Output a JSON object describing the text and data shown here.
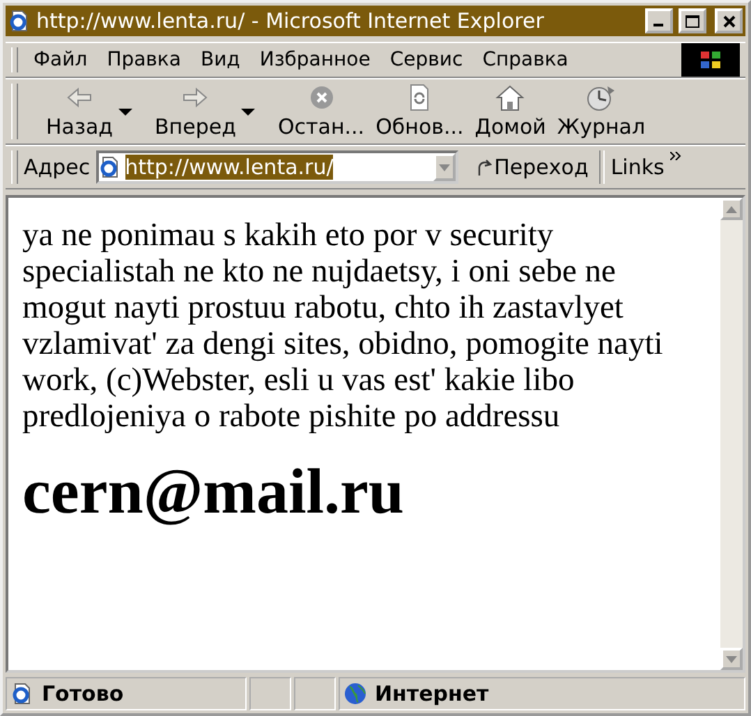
{
  "window": {
    "title": "http://www.lenta.ru/ - Microsoft Internet Explorer"
  },
  "menu": [
    "Файл",
    "Правка",
    "Вид",
    "Избранное",
    "Сервис",
    "Справка"
  ],
  "toolbar": [
    {
      "label": "Назад",
      "dropdown": true
    },
    {
      "label": "Вперед",
      "dropdown": true
    },
    {
      "label": "Остан...",
      "dropdown": false
    },
    {
      "label": "Обнов...",
      "dropdown": false
    },
    {
      "label": "Домой",
      "dropdown": false
    },
    {
      "label": "Журнал",
      "dropdown": false
    }
  ],
  "address": {
    "label": "Адрес",
    "value": "http://www.lenta.ru/",
    "go": "Переход",
    "links": "Links"
  },
  "content": {
    "paragraph": "ya ne ponimau s kakih eto por v security specialistah ne kto ne nujdaetsy, i oni sebe ne mogut nayti prostuu rabotu, chto ih zastavlyet vzlamivat' za dengi sites, obidno, pomogite nayti work, (c)Webster, esli u vas est' kakie libo predlojeniya o rabote pishite po addressu",
    "email": "cern@mail.ru"
  },
  "status_bar": {
    "status": "Готово",
    "zone": "Интернет"
  }
}
